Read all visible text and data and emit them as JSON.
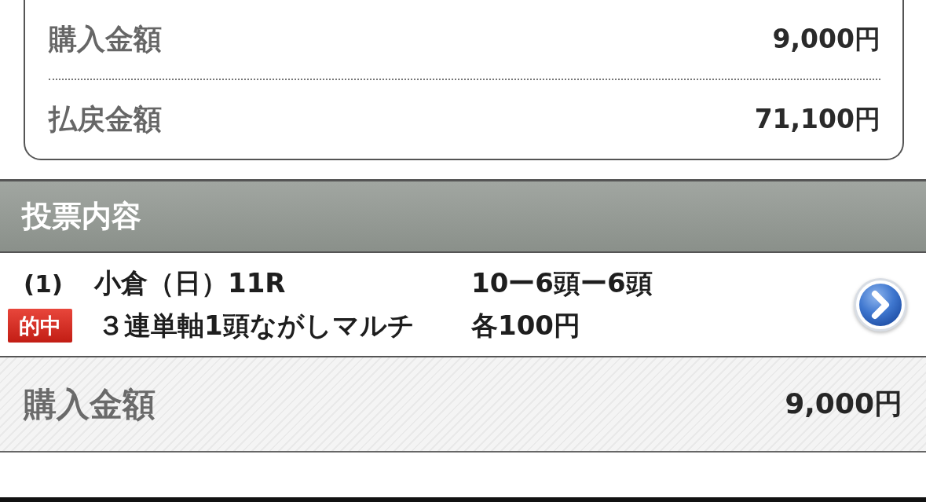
{
  "summary_card": {
    "rows": [
      {
        "label": "購入金額",
        "value": "9,000円"
      },
      {
        "label": "払戻金額",
        "value": "71,100円"
      }
    ]
  },
  "section_header": {
    "title": "投票内容"
  },
  "bets": [
    {
      "number": "(1)",
      "race": "小倉（日）11R",
      "combination": "10ー6頭ー6頭",
      "badge": "的中",
      "bet_type": "３連単軸1頭ながしマルチ",
      "amount": "各100円"
    }
  ],
  "total": {
    "label": "購入金額",
    "value": "9,000円"
  }
}
